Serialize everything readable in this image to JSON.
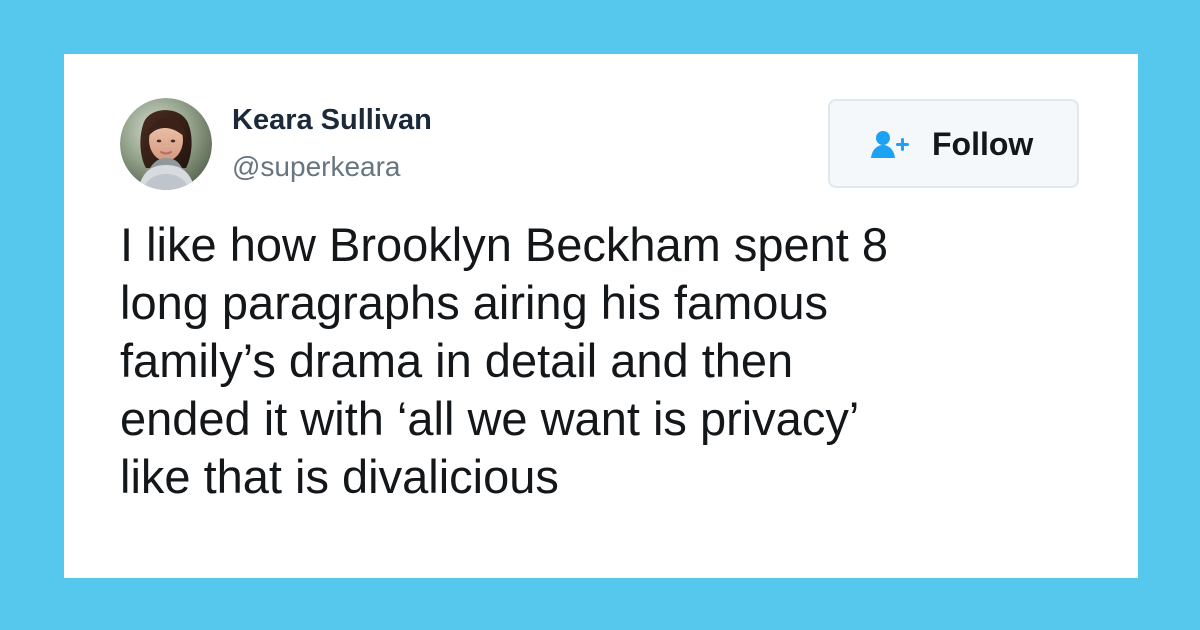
{
  "tweet": {
    "author": {
      "name": "Keara Sullivan",
      "handle": "@superkeara",
      "avatar": "profile-photo"
    },
    "follow_button": {
      "label": "Follow",
      "icon": "add-user-icon",
      "accent_color": "#1da1f2"
    },
    "text": "I like how Brooklyn Beckham spent 8\nlong paragraphs airing his famous\nfamily’s drama in detail and then\nended it with ‘all we want is privacy’\nlike that is divalicious"
  },
  "colors": {
    "background": "#56c8ee",
    "card": "#ffffff",
    "name_text": "#1c2938",
    "handle_text": "#66757f",
    "body_text": "#14171a",
    "button_background": "#f5f8fa",
    "button_border": "#e1e8ed"
  }
}
